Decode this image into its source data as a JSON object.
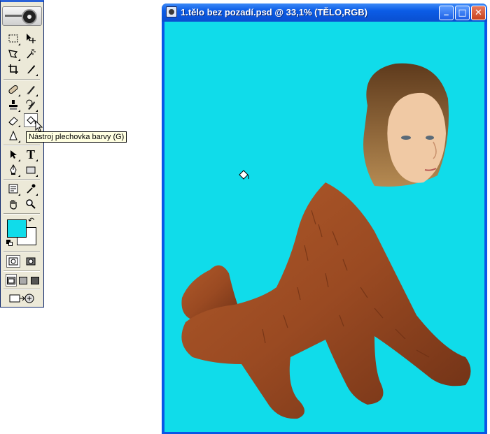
{
  "toolbox": {
    "tools": [
      {
        "name": "rectangular-marquee-tool",
        "icon": "marquee-icon"
      },
      {
        "name": "move-tool",
        "icon": "move-icon"
      },
      {
        "name": "lasso-tool",
        "icon": "lasso-icon"
      },
      {
        "name": "magic-wand-tool",
        "icon": "magic-wand-icon"
      },
      {
        "name": "crop-tool",
        "icon": "crop-icon"
      },
      {
        "name": "slice-tool",
        "icon": "slice-icon"
      },
      {
        "name": "healing-brush-tool",
        "icon": "bandage-icon"
      },
      {
        "name": "brush-tool",
        "icon": "brush-icon"
      },
      {
        "name": "clone-stamp-tool",
        "icon": "stamp-icon"
      },
      {
        "name": "history-brush-tool",
        "icon": "history-brush-icon"
      },
      {
        "name": "eraser-tool",
        "icon": "eraser-icon"
      },
      {
        "name": "paint-bucket-tool",
        "icon": "paint-bucket-icon",
        "active": true
      },
      {
        "name": "blur-tool",
        "icon": "blur-icon"
      },
      {
        "name": "dodge-tool",
        "icon": "dodge-icon"
      },
      {
        "name": "path-selection-tool",
        "icon": "arrow-icon"
      },
      {
        "name": "type-tool",
        "icon": "type-icon",
        "text": "T"
      },
      {
        "name": "pen-tool",
        "icon": "pen-icon"
      },
      {
        "name": "shape-tool",
        "icon": "rectangle-icon"
      },
      {
        "name": "notes-tool",
        "icon": "notes-icon"
      },
      {
        "name": "eyedropper-tool",
        "icon": "eyedropper-icon"
      },
      {
        "name": "hand-tool",
        "icon": "hand-icon"
      },
      {
        "name": "zoom-tool",
        "icon": "zoom-icon"
      }
    ],
    "colors": {
      "foreground": "#10dcea",
      "background": "#ffffff"
    }
  },
  "tooltip": {
    "text": "Nástroj plechovka barvy (G)"
  },
  "document": {
    "title": "1.tělo bez pozadí.psd @ 33,1% (TĚLO,RGB)",
    "canvas_color": "#10dcea",
    "buttons": {
      "minimize": "_",
      "maximize": "□",
      "close": "✕"
    }
  }
}
